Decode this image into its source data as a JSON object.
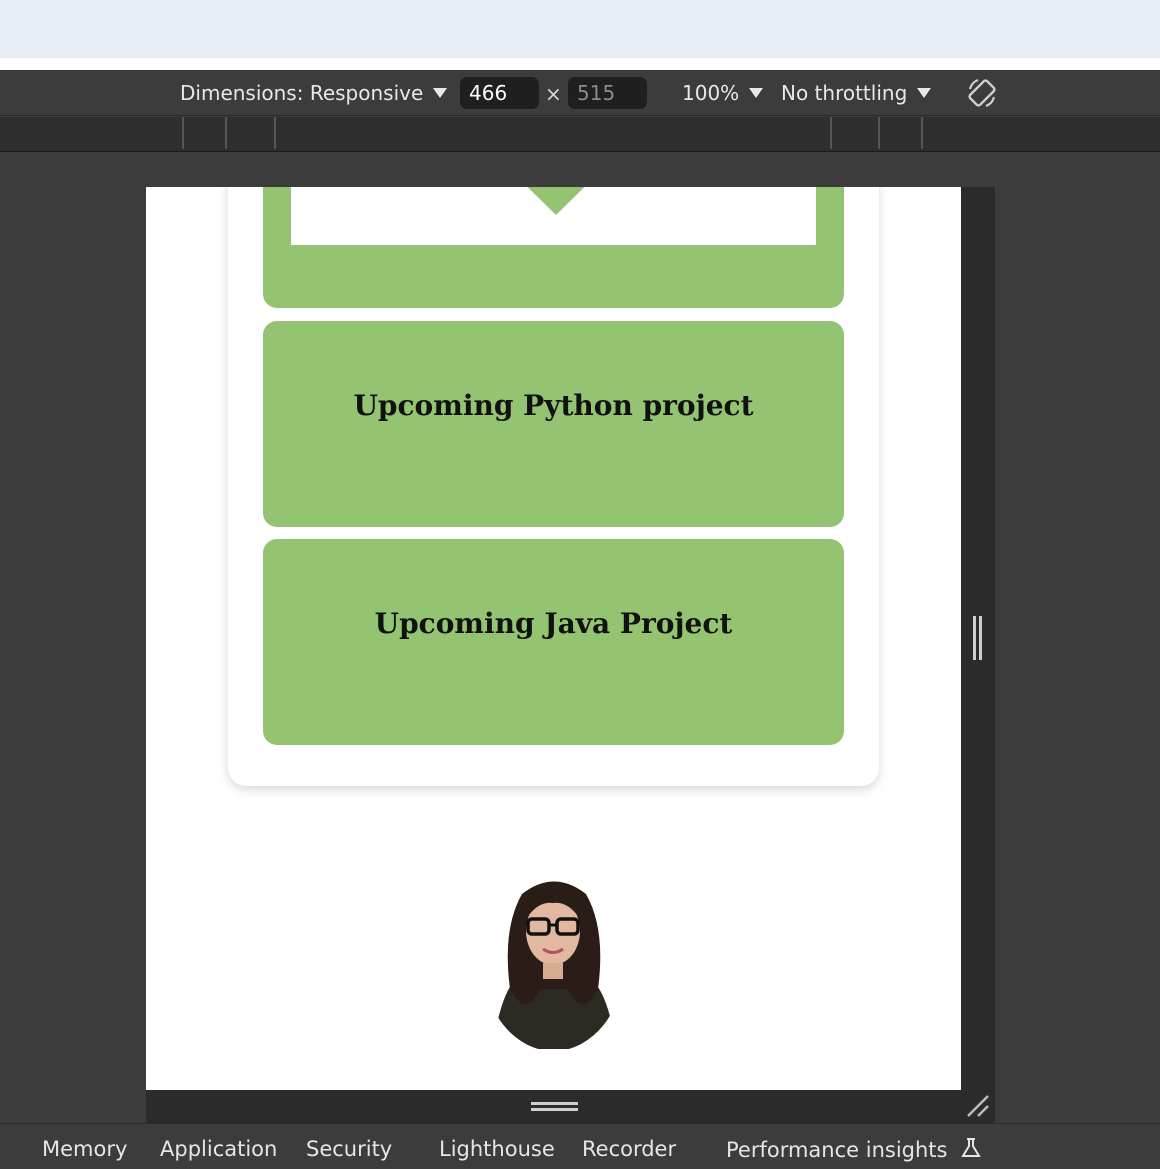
{
  "devtools_toolbar": {
    "dimensions_label": "Dimensions: Responsive",
    "width_value": "466",
    "height_value": "515",
    "times_symbol": "×",
    "zoom_label": "100%",
    "throttling_label": "No throttling",
    "rotate_icon": "rotate-icon"
  },
  "page": {
    "projects": [
      {
        "title": ""
      },
      {
        "title": "Upcoming Python project"
      },
      {
        "title": "Upcoming Java Project"
      }
    ],
    "avatar_alt": "profile photo"
  },
  "bottom_tabs": [
    {
      "label": "Memory"
    },
    {
      "label": "Application"
    },
    {
      "label": "Security"
    },
    {
      "label": "Lighthouse"
    },
    {
      "label": "Recorder"
    },
    {
      "label": "Performance insights"
    }
  ],
  "colors": {
    "project_card_green": "#94c472",
    "devtools_bg": "#3c3c3c",
    "toolbar_input_bg": "#1f1f1f"
  }
}
